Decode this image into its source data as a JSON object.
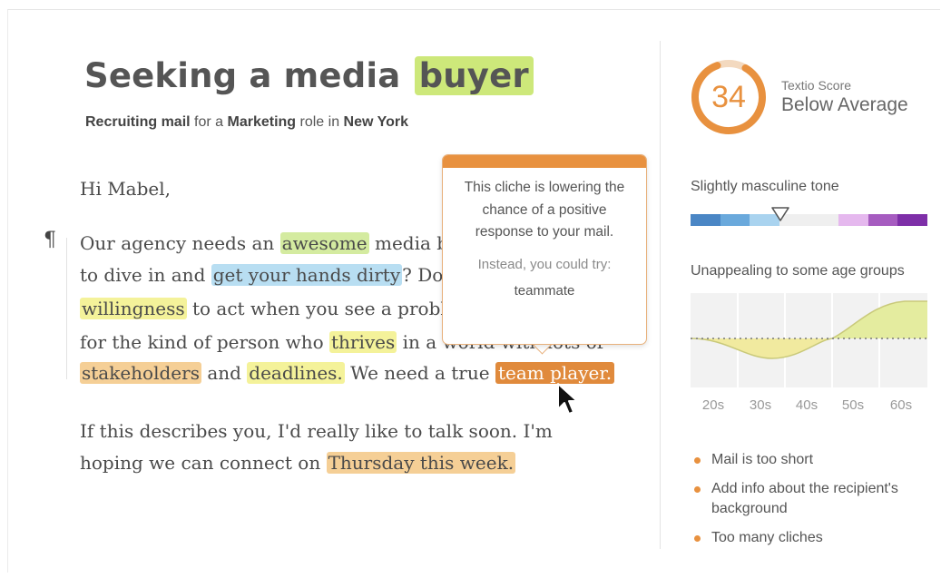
{
  "header": {
    "title_prefix": "Seeking a media ",
    "title_highlight": "buyer",
    "sub_1": "Recruiting mail",
    "sub_2": " for a ",
    "sub_3": "Marketing",
    "sub_4": " role in ",
    "sub_5": "New York"
  },
  "letter": {
    "greeting": "Hi Mabel,",
    "pilcrow": "¶",
    "p1": {
      "l1a": "Our agency needs an ",
      "l1b": "awesome",
      "l1c": " media b",
      "l2a": "to dive in and ",
      "l2b": "get your hands dirty",
      "l2c": "? Do",
      "l3a": "willingness",
      "l3b": " to act when you see a probl",
      "l4a": "for the kind of person who ",
      "l4b": "thrives",
      "l4c": " in a world with lots of",
      "l5a": "stakeholders",
      "l5b": " and ",
      "l5c": "deadlines.",
      "l5d": " We need a true ",
      "l5e": "team player."
    },
    "p2": {
      "l1": "If this describes you, I'd really like to talk soon. I'm",
      "l2a": "hoping we can connect on ",
      "l2b": "Thursday this week."
    }
  },
  "tooltip": {
    "message": "This cliche is lowering the chance of a positive response to your mail.",
    "try_label": "Instead, you could try:",
    "suggestion": "teammate"
  },
  "score": {
    "value": "34",
    "label": "Textio Score",
    "rating": "Below Average",
    "color": "#e8913f"
  },
  "tone": {
    "label": "Slightly masculine tone",
    "colors": [
      "#4a86c5",
      "#6aa9dc",
      "#a9d3ef",
      "#efefef",
      "#efefef",
      "#e5b8ee",
      "#a65cc0",
      "#7e2fa8"
    ]
  },
  "age": {
    "label": "Unappealing to some age groups",
    "ticks": [
      "20s",
      "30s",
      "40s",
      "50s",
      "60s"
    ]
  },
  "issues": [
    "Mail is too short",
    "Add info about the recipient's background",
    "Too many cliches"
  ]
}
